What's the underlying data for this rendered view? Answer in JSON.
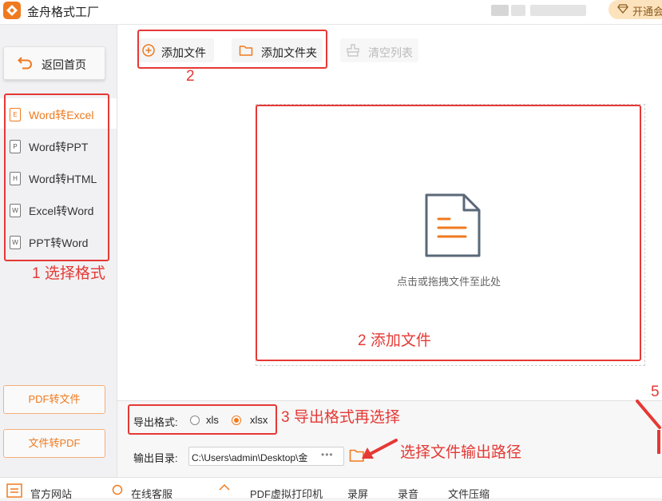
{
  "app": {
    "title": "金舟格式工厂",
    "vip_label": "开通会"
  },
  "sidebar": {
    "home_label": "返回首页",
    "items": [
      {
        "icon_letter": "E",
        "label": "Word转Excel"
      },
      {
        "icon_letter": "P",
        "label": "Word转PPT"
      },
      {
        "icon_letter": "H",
        "label": "Word转HTML"
      },
      {
        "icon_letter": "W",
        "label": "Excel转Word"
      },
      {
        "icon_letter": "W",
        "label": "PPT转Word"
      }
    ],
    "pdf_to_file": "PDF转文件",
    "file_to_pdf": "文件转PDF"
  },
  "toolbar": {
    "add_file": "添加文件",
    "add_folder": "添加文件夹",
    "clear_list": "清空列表"
  },
  "dropzone": {
    "hint": "点击或拖拽文件至此处"
  },
  "output": {
    "format_label": "导出格式:",
    "options": [
      "xls",
      "xlsx"
    ],
    "selected": "xlsx",
    "dir_label": "输出目录:",
    "dir_value": "C:\\Users\\admin\\Desktop\\金",
    "dir_more": "•••"
  },
  "statusbar": [
    "官方网站",
    "在线客服",
    "PDF虚拟打印机",
    "录屏",
    "录音",
    "文件压缩"
  ],
  "annotations": {
    "toolbar_num": "2",
    "select_format": "1 选择格式",
    "add_file": "2 添加文件",
    "export_format": "3 导出格式再选择",
    "output_path": "选择文件输出路径",
    "five": "5"
  },
  "colors": {
    "accent": "#f07a1f",
    "annotation": "#e53935"
  }
}
